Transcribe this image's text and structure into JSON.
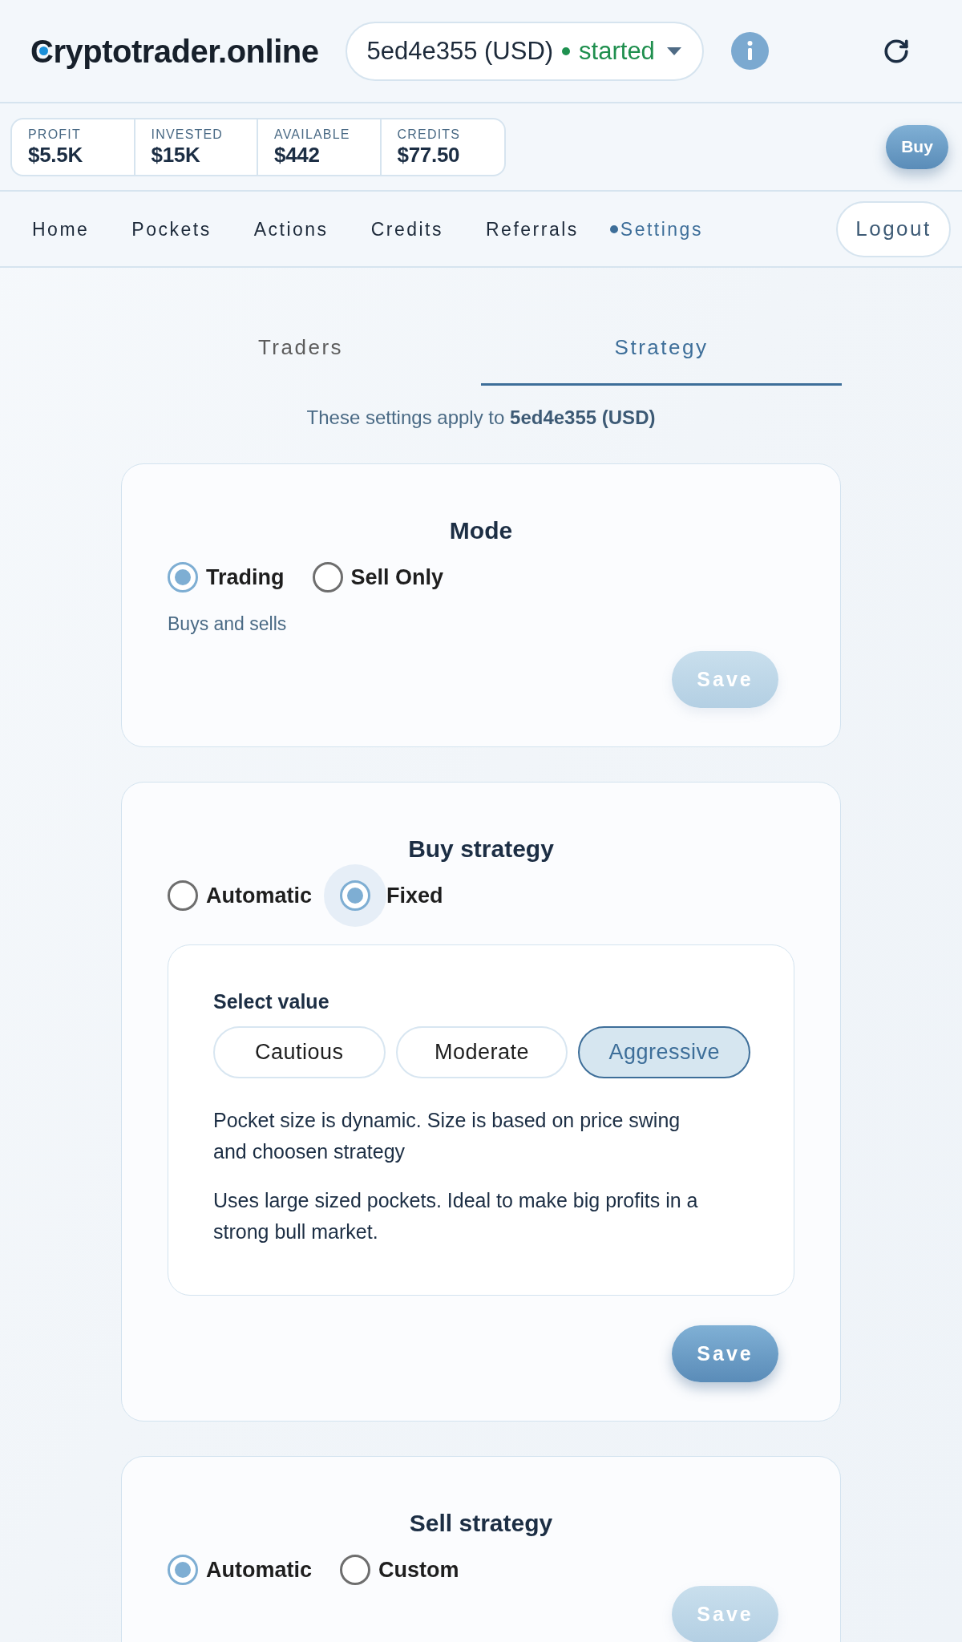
{
  "header": {
    "logo": "Cryptotrader.online",
    "trader_selector": {
      "name": "5ed4e355 (USD)",
      "status": "started"
    }
  },
  "stats": [
    {
      "label": "PROFIT",
      "value": "$5.5K"
    },
    {
      "label": "INVESTED",
      "value": "$15K"
    },
    {
      "label": "AVAILABLE",
      "value": "$442"
    },
    {
      "label": "CREDITS",
      "value": "$77.50"
    }
  ],
  "buy_button": "Buy",
  "nav": {
    "items": [
      {
        "label": "Home",
        "selected": false
      },
      {
        "label": "Pockets",
        "selected": false
      },
      {
        "label": "Actions",
        "selected": false
      },
      {
        "label": "Credits",
        "selected": false
      },
      {
        "label": "Referrals",
        "selected": false
      },
      {
        "label": "Settings",
        "selected": true
      }
    ],
    "logout": "Logout"
  },
  "tabs": [
    {
      "label": "Traders",
      "selected": false
    },
    {
      "label": "Strategy",
      "selected": true
    }
  ],
  "note": "These settings apply to **5ed4e355 (USD)**",
  "cards": [
    {
      "title": "Mode",
      "options": [
        {
          "label": "Trading",
          "selected": true,
          "focused": false
        },
        {
          "label": "Sell Only",
          "selected": false,
          "focused": false
        }
      ],
      "description": "Buys and sells",
      "save": {
        "label": "Save",
        "disabled": true
      }
    },
    {
      "title": "Buy strategy",
      "options": [
        {
          "label": "Automatic",
          "selected": false,
          "focused": false
        },
        {
          "label": "Fixed",
          "selected": true,
          "focused": true
        }
      ],
      "panel": {
        "title": "Select value",
        "choices": [
          {
            "label": "Cautious",
            "selected": false
          },
          {
            "label": "Moderate",
            "selected": false
          },
          {
            "label": "Aggressive",
            "selected": true
          }
        ],
        "paragraphs": [
          "Pocket size is dynamic. Size is based on price swing and choosen strategy",
          "Uses large sized pockets. Ideal to make big profits in a strong bull market."
        ]
      },
      "save": {
        "label": "Save",
        "disabled": false
      }
    },
    {
      "title": "Sell strategy",
      "options": [
        {
          "label": "Automatic",
          "selected": true,
          "focused": false
        },
        {
          "label": "Custom",
          "selected": false,
          "focused": false
        }
      ],
      "save": {
        "label": "Save",
        "disabled": true
      }
    }
  ]
}
